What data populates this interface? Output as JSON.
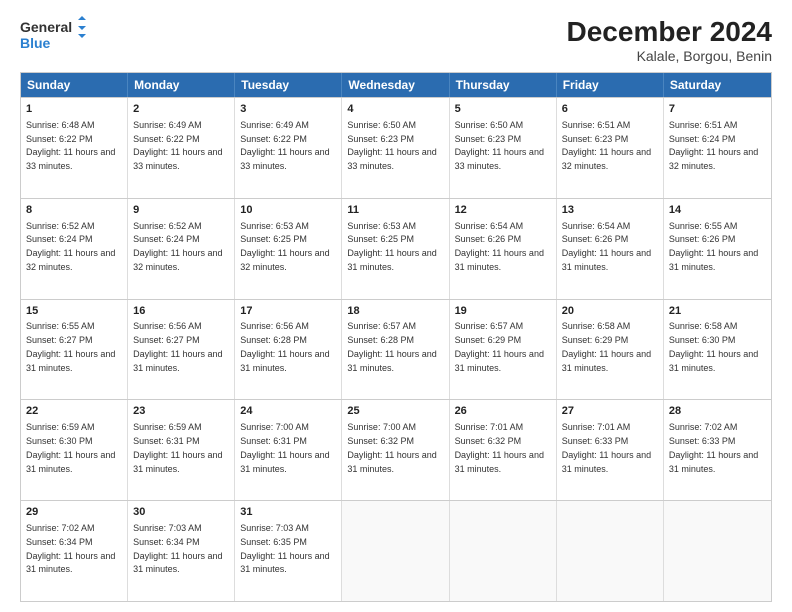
{
  "header": {
    "logo_line1": "General",
    "logo_line2": "Blue",
    "title": "December 2024",
    "subtitle": "Kalale, Borgou, Benin"
  },
  "calendar": {
    "days": [
      "Sunday",
      "Monday",
      "Tuesday",
      "Wednesday",
      "Thursday",
      "Friday",
      "Saturday"
    ],
    "weeks": [
      [
        {
          "day": "1",
          "sunrise": "6:48 AM",
          "sunset": "6:22 PM",
          "daylight": "11 hours and 33 minutes."
        },
        {
          "day": "2",
          "sunrise": "6:49 AM",
          "sunset": "6:22 PM",
          "daylight": "11 hours and 33 minutes."
        },
        {
          "day": "3",
          "sunrise": "6:49 AM",
          "sunset": "6:22 PM",
          "daylight": "11 hours and 33 minutes."
        },
        {
          "day": "4",
          "sunrise": "6:50 AM",
          "sunset": "6:23 PM",
          "daylight": "11 hours and 33 minutes."
        },
        {
          "day": "5",
          "sunrise": "6:50 AM",
          "sunset": "6:23 PM",
          "daylight": "11 hours and 33 minutes."
        },
        {
          "day": "6",
          "sunrise": "6:51 AM",
          "sunset": "6:23 PM",
          "daylight": "11 hours and 32 minutes."
        },
        {
          "day": "7",
          "sunrise": "6:51 AM",
          "sunset": "6:24 PM",
          "daylight": "11 hours and 32 minutes."
        }
      ],
      [
        {
          "day": "8",
          "sunrise": "6:52 AM",
          "sunset": "6:24 PM",
          "daylight": "11 hours and 32 minutes."
        },
        {
          "day": "9",
          "sunrise": "6:52 AM",
          "sunset": "6:24 PM",
          "daylight": "11 hours and 32 minutes."
        },
        {
          "day": "10",
          "sunrise": "6:53 AM",
          "sunset": "6:25 PM",
          "daylight": "11 hours and 32 minutes."
        },
        {
          "day": "11",
          "sunrise": "6:53 AM",
          "sunset": "6:25 PM",
          "daylight": "11 hours and 31 minutes."
        },
        {
          "day": "12",
          "sunrise": "6:54 AM",
          "sunset": "6:26 PM",
          "daylight": "11 hours and 31 minutes."
        },
        {
          "day": "13",
          "sunrise": "6:54 AM",
          "sunset": "6:26 PM",
          "daylight": "11 hours and 31 minutes."
        },
        {
          "day": "14",
          "sunrise": "6:55 AM",
          "sunset": "6:26 PM",
          "daylight": "11 hours and 31 minutes."
        }
      ],
      [
        {
          "day": "15",
          "sunrise": "6:55 AM",
          "sunset": "6:27 PM",
          "daylight": "11 hours and 31 minutes."
        },
        {
          "day": "16",
          "sunrise": "6:56 AM",
          "sunset": "6:27 PM",
          "daylight": "11 hours and 31 minutes."
        },
        {
          "day": "17",
          "sunrise": "6:56 AM",
          "sunset": "6:28 PM",
          "daylight": "11 hours and 31 minutes."
        },
        {
          "day": "18",
          "sunrise": "6:57 AM",
          "sunset": "6:28 PM",
          "daylight": "11 hours and 31 minutes."
        },
        {
          "day": "19",
          "sunrise": "6:57 AM",
          "sunset": "6:29 PM",
          "daylight": "11 hours and 31 minutes."
        },
        {
          "day": "20",
          "sunrise": "6:58 AM",
          "sunset": "6:29 PM",
          "daylight": "11 hours and 31 minutes."
        },
        {
          "day": "21",
          "sunrise": "6:58 AM",
          "sunset": "6:30 PM",
          "daylight": "11 hours and 31 minutes."
        }
      ],
      [
        {
          "day": "22",
          "sunrise": "6:59 AM",
          "sunset": "6:30 PM",
          "daylight": "11 hours and 31 minutes."
        },
        {
          "day": "23",
          "sunrise": "6:59 AM",
          "sunset": "6:31 PM",
          "daylight": "11 hours and 31 minutes."
        },
        {
          "day": "24",
          "sunrise": "7:00 AM",
          "sunset": "6:31 PM",
          "daylight": "11 hours and 31 minutes."
        },
        {
          "day": "25",
          "sunrise": "7:00 AM",
          "sunset": "6:32 PM",
          "daylight": "11 hours and 31 minutes."
        },
        {
          "day": "26",
          "sunrise": "7:01 AM",
          "sunset": "6:32 PM",
          "daylight": "11 hours and 31 minutes."
        },
        {
          "day": "27",
          "sunrise": "7:01 AM",
          "sunset": "6:33 PM",
          "daylight": "11 hours and 31 minutes."
        },
        {
          "day": "28",
          "sunrise": "7:02 AM",
          "sunset": "6:33 PM",
          "daylight": "11 hours and 31 minutes."
        }
      ],
      [
        {
          "day": "29",
          "sunrise": "7:02 AM",
          "sunset": "6:34 PM",
          "daylight": "11 hours and 31 minutes."
        },
        {
          "day": "30",
          "sunrise": "7:03 AM",
          "sunset": "6:34 PM",
          "daylight": "11 hours and 31 minutes."
        },
        {
          "day": "31",
          "sunrise": "7:03 AM",
          "sunset": "6:35 PM",
          "daylight": "11 hours and 31 minutes."
        },
        null,
        null,
        null,
        null
      ]
    ]
  }
}
